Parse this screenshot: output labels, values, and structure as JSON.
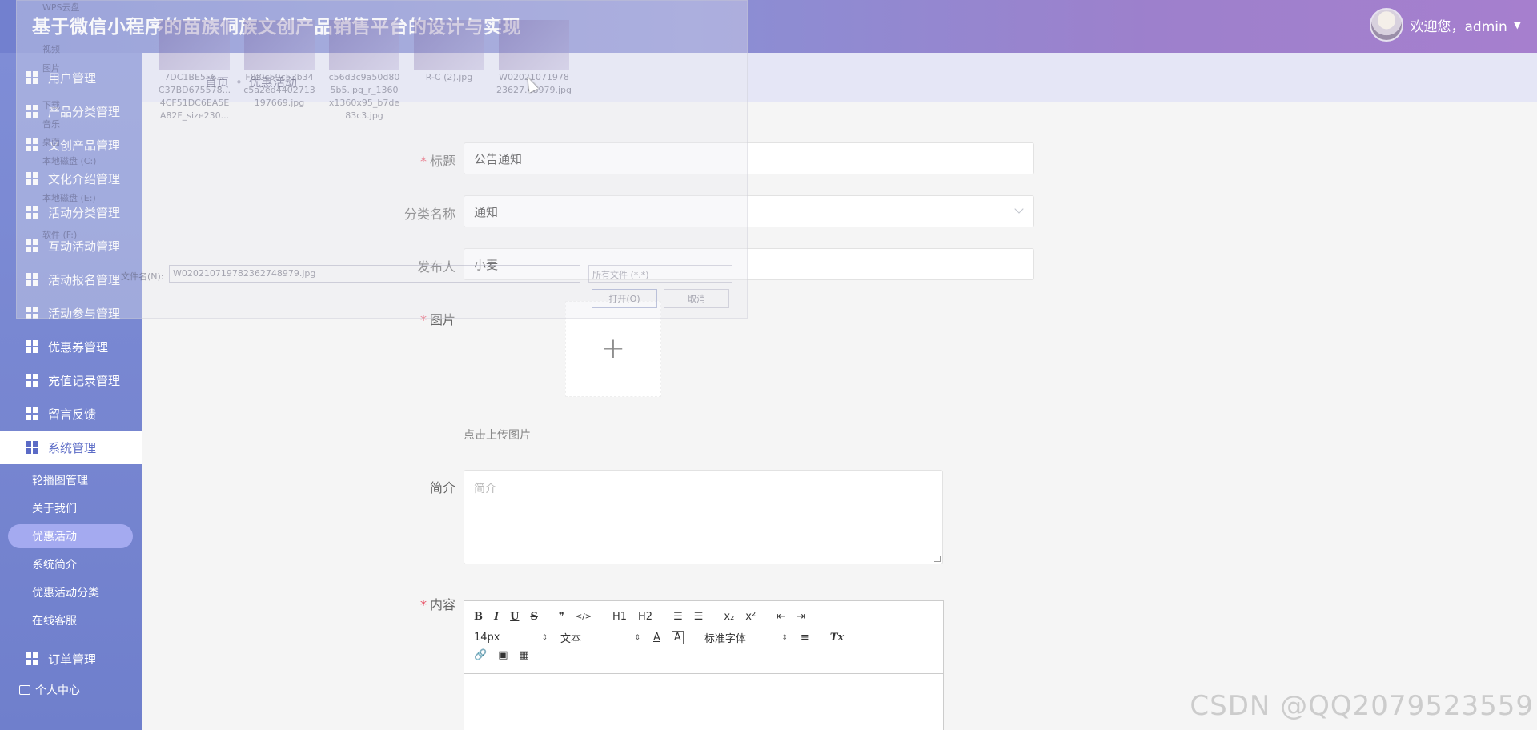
{
  "header": {
    "title": "基于微信小程序的苗族侗族文创产品销售平台的设计与实现",
    "welcome": "欢迎您，admin",
    "caret": "▼"
  },
  "sidebar": {
    "items": [
      {
        "label": "用户管理"
      },
      {
        "label": "产品分类管理"
      },
      {
        "label": "文创产品管理"
      },
      {
        "label": "文化介绍管理"
      },
      {
        "label": "活动分类管理"
      },
      {
        "label": "互动活动管理"
      },
      {
        "label": "活动报名管理"
      },
      {
        "label": "活动参与管理"
      },
      {
        "label": "优惠券管理"
      },
      {
        "label": "充值记录管理"
      },
      {
        "label": "留言反馈"
      },
      {
        "label": "系统管理"
      }
    ],
    "sub_items": [
      {
        "label": "轮播图管理"
      },
      {
        "label": "关于我们"
      },
      {
        "label": "优惠活动"
      },
      {
        "label": "系统简介"
      },
      {
        "label": "优惠活动分类"
      },
      {
        "label": "在线客服"
      }
    ],
    "orders": "订单管理",
    "personal": "个人中心"
  },
  "breadcrumb": {
    "home": "首页",
    "sep": "•",
    "current": "优惠活动"
  },
  "form": {
    "title_label": "标题",
    "title_value": "公告通知",
    "category_label": "分类名称",
    "category_value": "通知",
    "publisher_label": "发布人",
    "publisher_value": "小麦",
    "image_label": "图片",
    "upload_plus": "+",
    "upload_hint": "点击上传图片",
    "intro_label": "简介",
    "intro_placeholder": "简介",
    "content_label": "内容",
    "required_mark": "*"
  },
  "editor": {
    "row1": [
      "B",
      "I",
      "U",
      "S",
      "❞",
      "</>",
      "H1",
      "H2",
      "☰",
      "☰",
      "x₂",
      "x²",
      "⇤",
      "⇥"
    ],
    "font_size": "14px",
    "text_type": "文本",
    "font_family": "标准字体",
    "color_a": "A",
    "bg_a": "A",
    "align": "≡",
    "clear": "Tx",
    "row3": [
      "🔗",
      "▣",
      "▦"
    ]
  },
  "dialog": {
    "files": [
      {
        "name": "7DC1BE5F6... C37BD675578... 4CF51DC6EA5E A82F_size230..."
      },
      {
        "name": "F8f0c59c53b34 c5a2ed4402713 197669.jpg"
      },
      {
        "name": "c56d3c9a50d80 5b5.jpg_r_1360 x1360x95_b7de 83c3.jpg"
      },
      {
        "name": "R-C (2).jpg"
      },
      {
        "name": "W02021071978 23627.48979.jpg"
      }
    ],
    "side": [
      "WPS云盘",
      "视频",
      "图片",
      "下载",
      "音乐",
      "桌面",
      "本地磁盘 (C:)",
      "本地磁盘 (E:)",
      "软件 (F:)"
    ],
    "filename_label": "文件名(N):",
    "filename_value": "W020210719782362748979.jpg",
    "type_value": "所有文件 (*.*)",
    "open": "打开(O)",
    "cancel": "取消"
  },
  "watermark": "CSDN @QQ2079523559"
}
